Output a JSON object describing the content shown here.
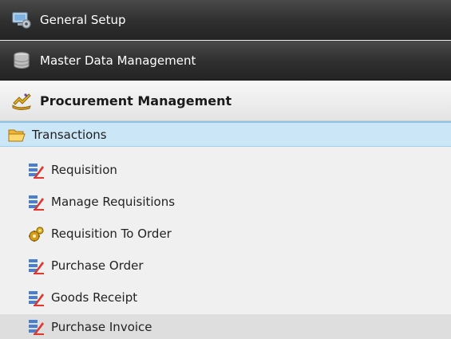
{
  "groups": [
    {
      "label": "General Setup",
      "icon": "computer-gear-icon"
    },
    {
      "label": "Master Data Management",
      "icon": "database-icon"
    },
    {
      "label": "Procurement Management",
      "icon": "procurement-icon"
    }
  ],
  "section": {
    "label": "Transactions",
    "icon": "folder-open-icon"
  },
  "items": [
    {
      "label": "Requisition",
      "icon": "form-edit-icon"
    },
    {
      "label": "Manage Requisitions",
      "icon": "form-edit-icon"
    },
    {
      "label": "Requisition To Order",
      "icon": "gear-icon"
    },
    {
      "label": "Purchase Order",
      "icon": "form-edit-icon"
    },
    {
      "label": "Goods Receipt",
      "icon": "form-edit-icon"
    },
    {
      "label": "Purchase Invoice",
      "icon": "form-edit-icon"
    }
  ],
  "colors": {
    "header_dark": "#2f2f2f",
    "section_bg": "#cbe7f7",
    "section_border": "#8ec4e6",
    "item_hover": "#dedede"
  }
}
